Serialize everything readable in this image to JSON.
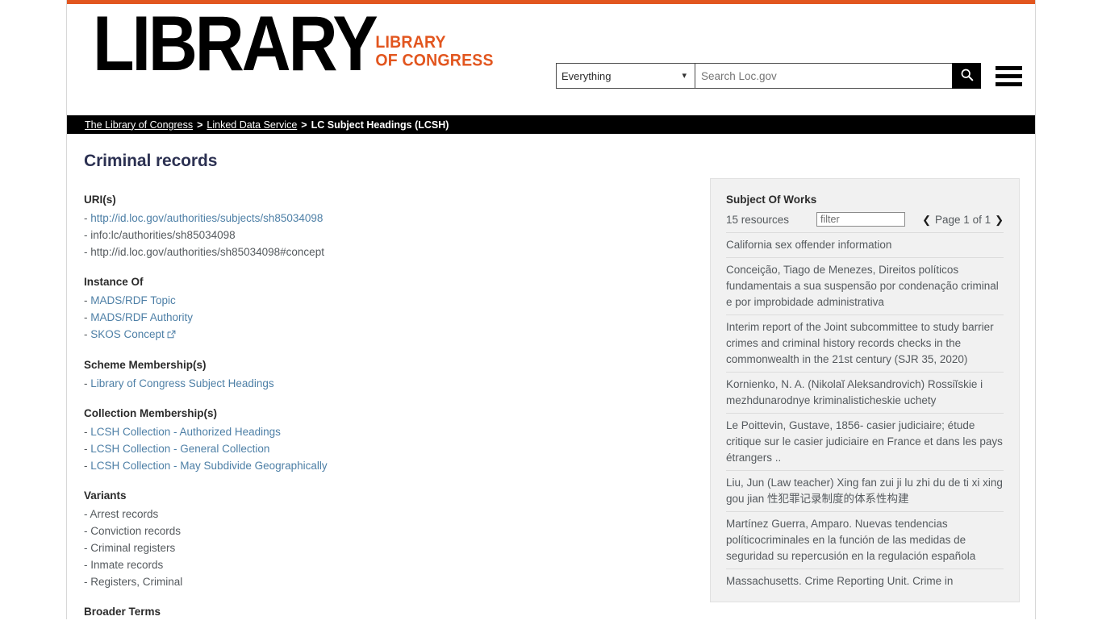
{
  "header": {
    "logo_main": "LIBRARY",
    "logo_sub_line1": "LIBRARY",
    "logo_sub_line2": "OF CONGRESS",
    "accent_color": "#e2561f",
    "search": {
      "scope_selected": "Everything",
      "scope_options": [
        "Everything"
      ],
      "placeholder": "Search Loc.gov",
      "value": "",
      "search_icon": "search-icon",
      "menu_icon": "hamburger-menu-icon"
    }
  },
  "breadcrumb": {
    "items": [
      {
        "label": "The Library of Congress",
        "is_link": true
      },
      {
        "label": "Linked Data Service",
        "is_link": true
      },
      {
        "label": "LC Subject Headings (LCSH)",
        "is_link": false
      }
    ],
    "separator": ">"
  },
  "main": {
    "title": "Criminal records",
    "groups": [
      {
        "label": "URI(s)",
        "items": [
          {
            "text": "http://id.loc.gov/authorities/subjects/sh85034098",
            "is_link": true
          },
          {
            "text": "info:lc/authorities/sh85034098",
            "is_link": false
          },
          {
            "text": "http://id.loc.gov/authorities/sh85034098#concept",
            "is_link": false
          }
        ]
      },
      {
        "label": "Instance Of",
        "items": [
          {
            "text": "MADS/RDF Topic",
            "is_link": true
          },
          {
            "text": "MADS/RDF Authority",
            "is_link": true
          },
          {
            "text": "SKOS Concept",
            "is_link": true,
            "external": true
          }
        ]
      },
      {
        "label": "Scheme Membership(s)",
        "items": [
          {
            "text": "Library of Congress Subject Headings",
            "is_link": true
          }
        ]
      },
      {
        "label": "Collection Membership(s)",
        "items": [
          {
            "text": "LCSH Collection - Authorized Headings",
            "is_link": true
          },
          {
            "text": "LCSH Collection - General Collection",
            "is_link": true
          },
          {
            "text": "LCSH Collection - May Subdivide Geographically",
            "is_link": true
          }
        ]
      },
      {
        "label": "Variants",
        "items": [
          {
            "text": "Arrest records",
            "is_link": false
          },
          {
            "text": "Conviction records",
            "is_link": false
          },
          {
            "text": "Criminal registers",
            "is_link": false
          },
          {
            "text": "Inmate records",
            "is_link": false
          },
          {
            "text": "Registers, Criminal",
            "is_link": false
          }
        ]
      },
      {
        "label": "Broader Terms",
        "items": []
      }
    ]
  },
  "side_panel": {
    "title": "Subject Of Works",
    "count_label": "15 resources",
    "filter_placeholder": "filter",
    "filter_value": "",
    "pager": {
      "prev_icon": "chevron-left-icon",
      "next_icon": "chevron-right-icon",
      "label": "Page 1 of 1"
    },
    "resources": [
      "California sex offender information",
      "Conceição, Tiago de Menezes, Direitos políticos fundamentais a sua suspensão por condenação criminal e por improbidade administrativa",
      "Interim report of the Joint subcommittee to study barrier crimes and criminal history records checks in the commonwealth in the 21st century (SJR 35, 2020)",
      "Kornienko, N. A. (Nikolaĭ Aleksandrovich) Rossiĭskie i mezhdunarodnye kriminalisticheskie uchety",
      "Le Poittevin, Gustave, 1856- casier judiciaire; étude critique sur le casier judiciaire en France et dans les pays étrangers ..",
      "Liu, Jun (Law teacher) Xing fan zui ji lu zhi du de ti xi xing gou jian 性犯罪记录制度的体系性构建",
      "Martínez Guerra, Amparo. Nuevas tendencias políticocriminales en la función de las medidas de seguridad su repercusión en la regulación española",
      "Massachusetts. Crime Reporting Unit. Crime in"
    ]
  }
}
